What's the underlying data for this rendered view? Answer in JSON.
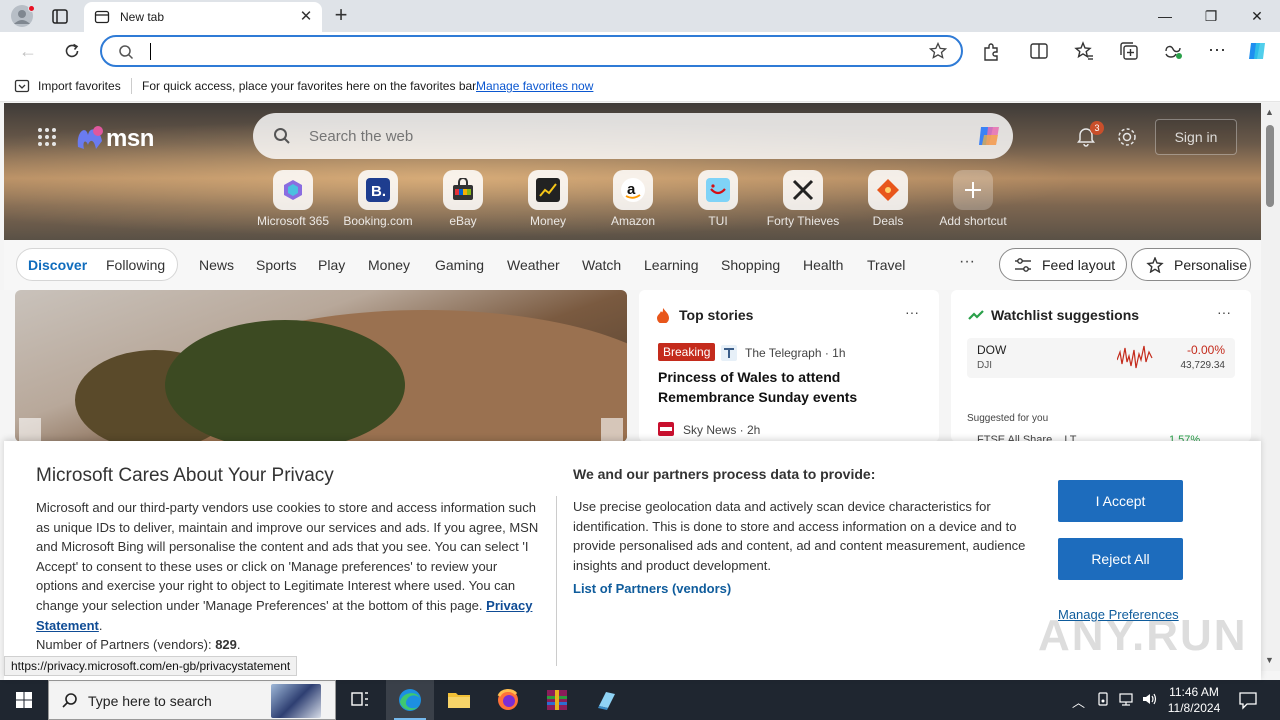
{
  "browser": {
    "tab_title": "New tab",
    "address_value": "",
    "favbar": {
      "import_label": "Import favorites",
      "message": "For quick access, place your favorites here on the favorites bar.",
      "manage_link": "Manage favorites now"
    }
  },
  "msn": {
    "logo_text": "msn",
    "search_placeholder": "Search the web",
    "notification_count": "3",
    "signin_label": "Sign in",
    "shortcuts": [
      {
        "label": "Microsoft 365",
        "icon": "microsoft365-icon"
      },
      {
        "label": "Booking.com",
        "icon": "booking-icon"
      },
      {
        "label": "eBay",
        "icon": "ebay-icon"
      },
      {
        "label": "Money",
        "icon": "money-icon"
      },
      {
        "label": "Amazon",
        "icon": "amazon-icon"
      },
      {
        "label": "TUI",
        "icon": "tui-icon"
      },
      {
        "label": "Forty Thieves",
        "icon": "forty-thieves-icon"
      },
      {
        "label": "Deals",
        "icon": "deals-icon"
      },
      {
        "label": "Add shortcut",
        "icon": "plus-icon"
      }
    ],
    "nav": {
      "discover": "Discover",
      "following": "Following",
      "items": [
        "News",
        "Sports",
        "Play",
        "Money",
        "Gaming",
        "Weather",
        "Watch",
        "Learning",
        "Shopping",
        "Health",
        "Travel"
      ],
      "more": "···",
      "feed_layout": "Feed layout",
      "personalise": "Personalise"
    },
    "top_stories": {
      "title": "Top stories",
      "more": "···",
      "badge": "Breaking",
      "source1": "The Telegraph · 1h",
      "headline1": "Princess of Wales to attend Remembrance Sunday events",
      "source2": "Sky News · 2h"
    },
    "watchlist": {
      "title": "Watchlist suggestions",
      "more": "···",
      "symbol": "DOW",
      "exchange": "DJI",
      "change": "-0.00%",
      "price": "43,729.34",
      "suggested": "Suggested for you",
      "next_symbol": "FTSE All Share ...LT",
      "next_change": "1.57%"
    }
  },
  "privacy": {
    "title": "Microsoft Cares About Your Privacy",
    "body": "Microsoft and our third-party vendors use cookies to store and access information such as unique IDs to deliver, maintain and improve our services and ads. If you agree, MSN and Microsoft Bing will personalise the content and ads that you see. You can select 'I Accept' to consent to these uses or click on 'Manage preferences' to review your options and exercise your right to object to Legitimate Interest where used.  You can change your selection under 'Manage Preferences' at the bottom of this page.",
    "privacy_link": "Privacy Statement",
    "partners_label": "Number of Partners (vendors):",
    "partners_count": "829",
    "purposes_title": "We and our partners process data to provide:",
    "purposes_text": "Use precise geolocation data and actively scan device characteristics for identification. This is done to store and access information on a device and to provide personalised ads and content, ad and content measurement, audience insights and product development.",
    "partners_link": "List of Partners (vendors)",
    "accept_label": "I Accept",
    "reject_label": "Reject All",
    "manage_label": "Manage Preferences"
  },
  "status_url": "https://privacy.microsoft.com/en-gb/privacystatement",
  "watermark": "ANY.RUN",
  "taskbar": {
    "search_placeholder": "Type here to search",
    "time": "11:46 AM",
    "date": "11/8/2024"
  },
  "colors": {
    "accent": "#1d6cbd",
    "link": "#0f5c9c",
    "breaking": "#c42b1c",
    "stock_down": "#c42b1c"
  }
}
